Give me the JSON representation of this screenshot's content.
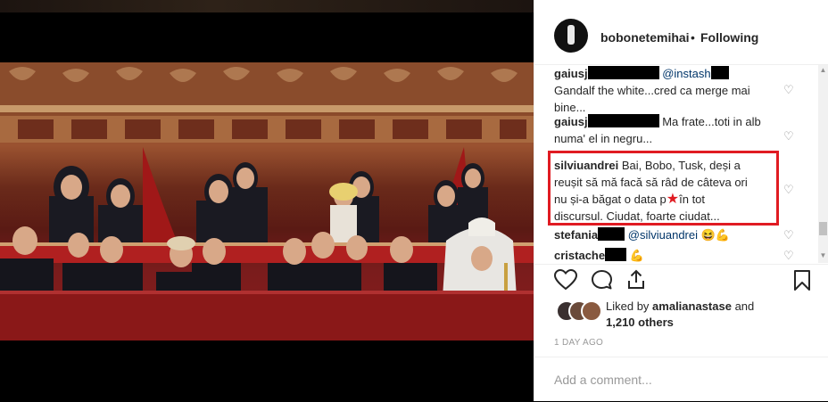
{
  "post": {
    "username": "bobonetemihai",
    "separator": "•",
    "follow_label": "Following"
  },
  "comments": [
    {
      "user": "gaiusj",
      "mention": "@instash",
      "text": "Gandalf the white...cred ca merge mai bine..."
    },
    {
      "user": "gaiusj",
      "text": "Ma frate...toti in alb numa' el in negru..."
    },
    {
      "user": "silviuandrei",
      "text_line1": "Bai, Bobo, Tusk, deși a",
      "text_line2": "reușit să mă facă să râd de câteva ori",
      "text_line3a": "nu și-a băgat o data p",
      "text_line3b": "în tot",
      "text_line4": "discursul. Ciudat, foarte ciudat..."
    },
    {
      "user": "stefania",
      "mention": "@silviuandrei",
      "emoji": "😆💪"
    },
    {
      "user": "cristache",
      "emoji": "💪"
    }
  ],
  "likes": {
    "liked_by_prefix": "Liked by",
    "liked_by_user": "amalianastase",
    "and_label": "and",
    "others_count": "1,210 others"
  },
  "timestamp": "1 DAY AGO",
  "add_comment": {
    "placeholder": "Add a comment..."
  },
  "colors": {
    "highlight": "#e01b22",
    "username": "#262626",
    "mention": "#003569",
    "muted": "#999999"
  },
  "icons": [
    "heart-icon",
    "comment-icon",
    "share-icon",
    "bookmark-icon",
    "like-heart-icon"
  ]
}
